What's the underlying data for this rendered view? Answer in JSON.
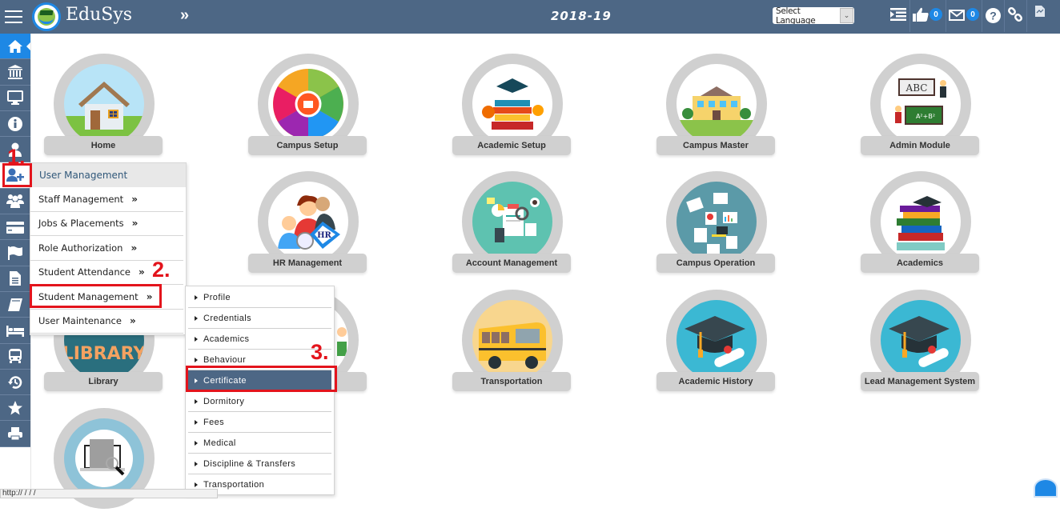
{
  "app": {
    "brand": "EduSys",
    "expand_glyph": "»",
    "year": "2018-19",
    "language_select": {
      "selected": "Select Language"
    }
  },
  "topbar": {
    "icons": [
      {
        "name": "list-icon"
      },
      {
        "name": "thumbs-up-icon",
        "badge": "0"
      },
      {
        "name": "envelope-icon",
        "badge": "0"
      },
      {
        "name": "help-icon"
      },
      {
        "name": "link-icon"
      },
      {
        "name": "document-icon"
      }
    ]
  },
  "sidebar": {
    "items": [
      {
        "icon": "home-icon",
        "active": true
      },
      {
        "icon": "institution-icon"
      },
      {
        "icon": "monitor-icon"
      },
      {
        "icon": "info-icon"
      },
      {
        "icon": "user-icon"
      },
      {
        "icon": "user-add-icon",
        "highlighted": true
      },
      {
        "icon": "users-group-icon"
      },
      {
        "icon": "credit-card-icon"
      },
      {
        "icon": "flag-icon"
      },
      {
        "icon": "file-icon"
      },
      {
        "icon": "book-icon"
      },
      {
        "icon": "bed-icon"
      },
      {
        "icon": "bus-icon"
      },
      {
        "icon": "history-icon"
      },
      {
        "icon": "star-icon"
      },
      {
        "icon": "print-icon"
      }
    ]
  },
  "tiles": [
    {
      "label": "Home"
    },
    {
      "label": "Campus Setup"
    },
    {
      "label": "Academic Setup"
    },
    {
      "label": "Campus Master"
    },
    {
      "label": "Admin Module"
    },
    {
      "label": "HR Management"
    },
    {
      "label": "Account Management"
    },
    {
      "label": "Campus Operation"
    },
    {
      "label": "Academics"
    },
    {
      "label": "Library"
    },
    {
      "label": "Transportation"
    },
    {
      "label": "Academic History"
    },
    {
      "label": "Lead Management System"
    }
  ],
  "tile_colors": {
    "home": "#9fd8ef",
    "campus_setup": "#ffffff",
    "academic_setup": "#ffffff",
    "campus_master": "#ffffff",
    "admin_module": "#ffffff",
    "hr": "#ffffff",
    "account": "#5ec2b0",
    "campus_operation": "#5b9aa8",
    "academics": "#ffffff",
    "library": "#2a6f7e",
    "transportation": "#f8d68e",
    "academic_history": "#3bb8d3",
    "lead": "#3bb8d3",
    "audit": "#8ec3d8"
  },
  "user_menu": {
    "header": "User Management",
    "items": [
      {
        "label": "Staff Management",
        "chevron": "»"
      },
      {
        "label": "Jobs & Placements",
        "chevron": "»"
      },
      {
        "label": "Role Authorization",
        "chevron": "»"
      },
      {
        "label": "Student Attendance",
        "chevron": "»"
      },
      {
        "label": "Student Management",
        "chevron": "»"
      },
      {
        "label": "User Maintenance",
        "chevron": "»"
      }
    ]
  },
  "student_submenu": {
    "items": [
      {
        "label": "Profile"
      },
      {
        "label": "Credentials"
      },
      {
        "label": "Academics"
      },
      {
        "label": "Behaviour"
      },
      {
        "label": "Certificate",
        "selected": true
      },
      {
        "label": "Dormitory"
      },
      {
        "label": "Fees"
      },
      {
        "label": "Medical"
      },
      {
        "label": "Discipline & Transfers"
      },
      {
        "label": "Transportation"
      }
    ]
  },
  "annotations": {
    "step1": "1.",
    "step2": "2.",
    "step3": "3.",
    "color": "#e3141c"
  },
  "statusbar": {
    "text": "http://                /                    /               /"
  },
  "colors": {
    "topbar": "#4d6785",
    "accent": "#1e88e5",
    "selected_item": "#4d6785"
  }
}
